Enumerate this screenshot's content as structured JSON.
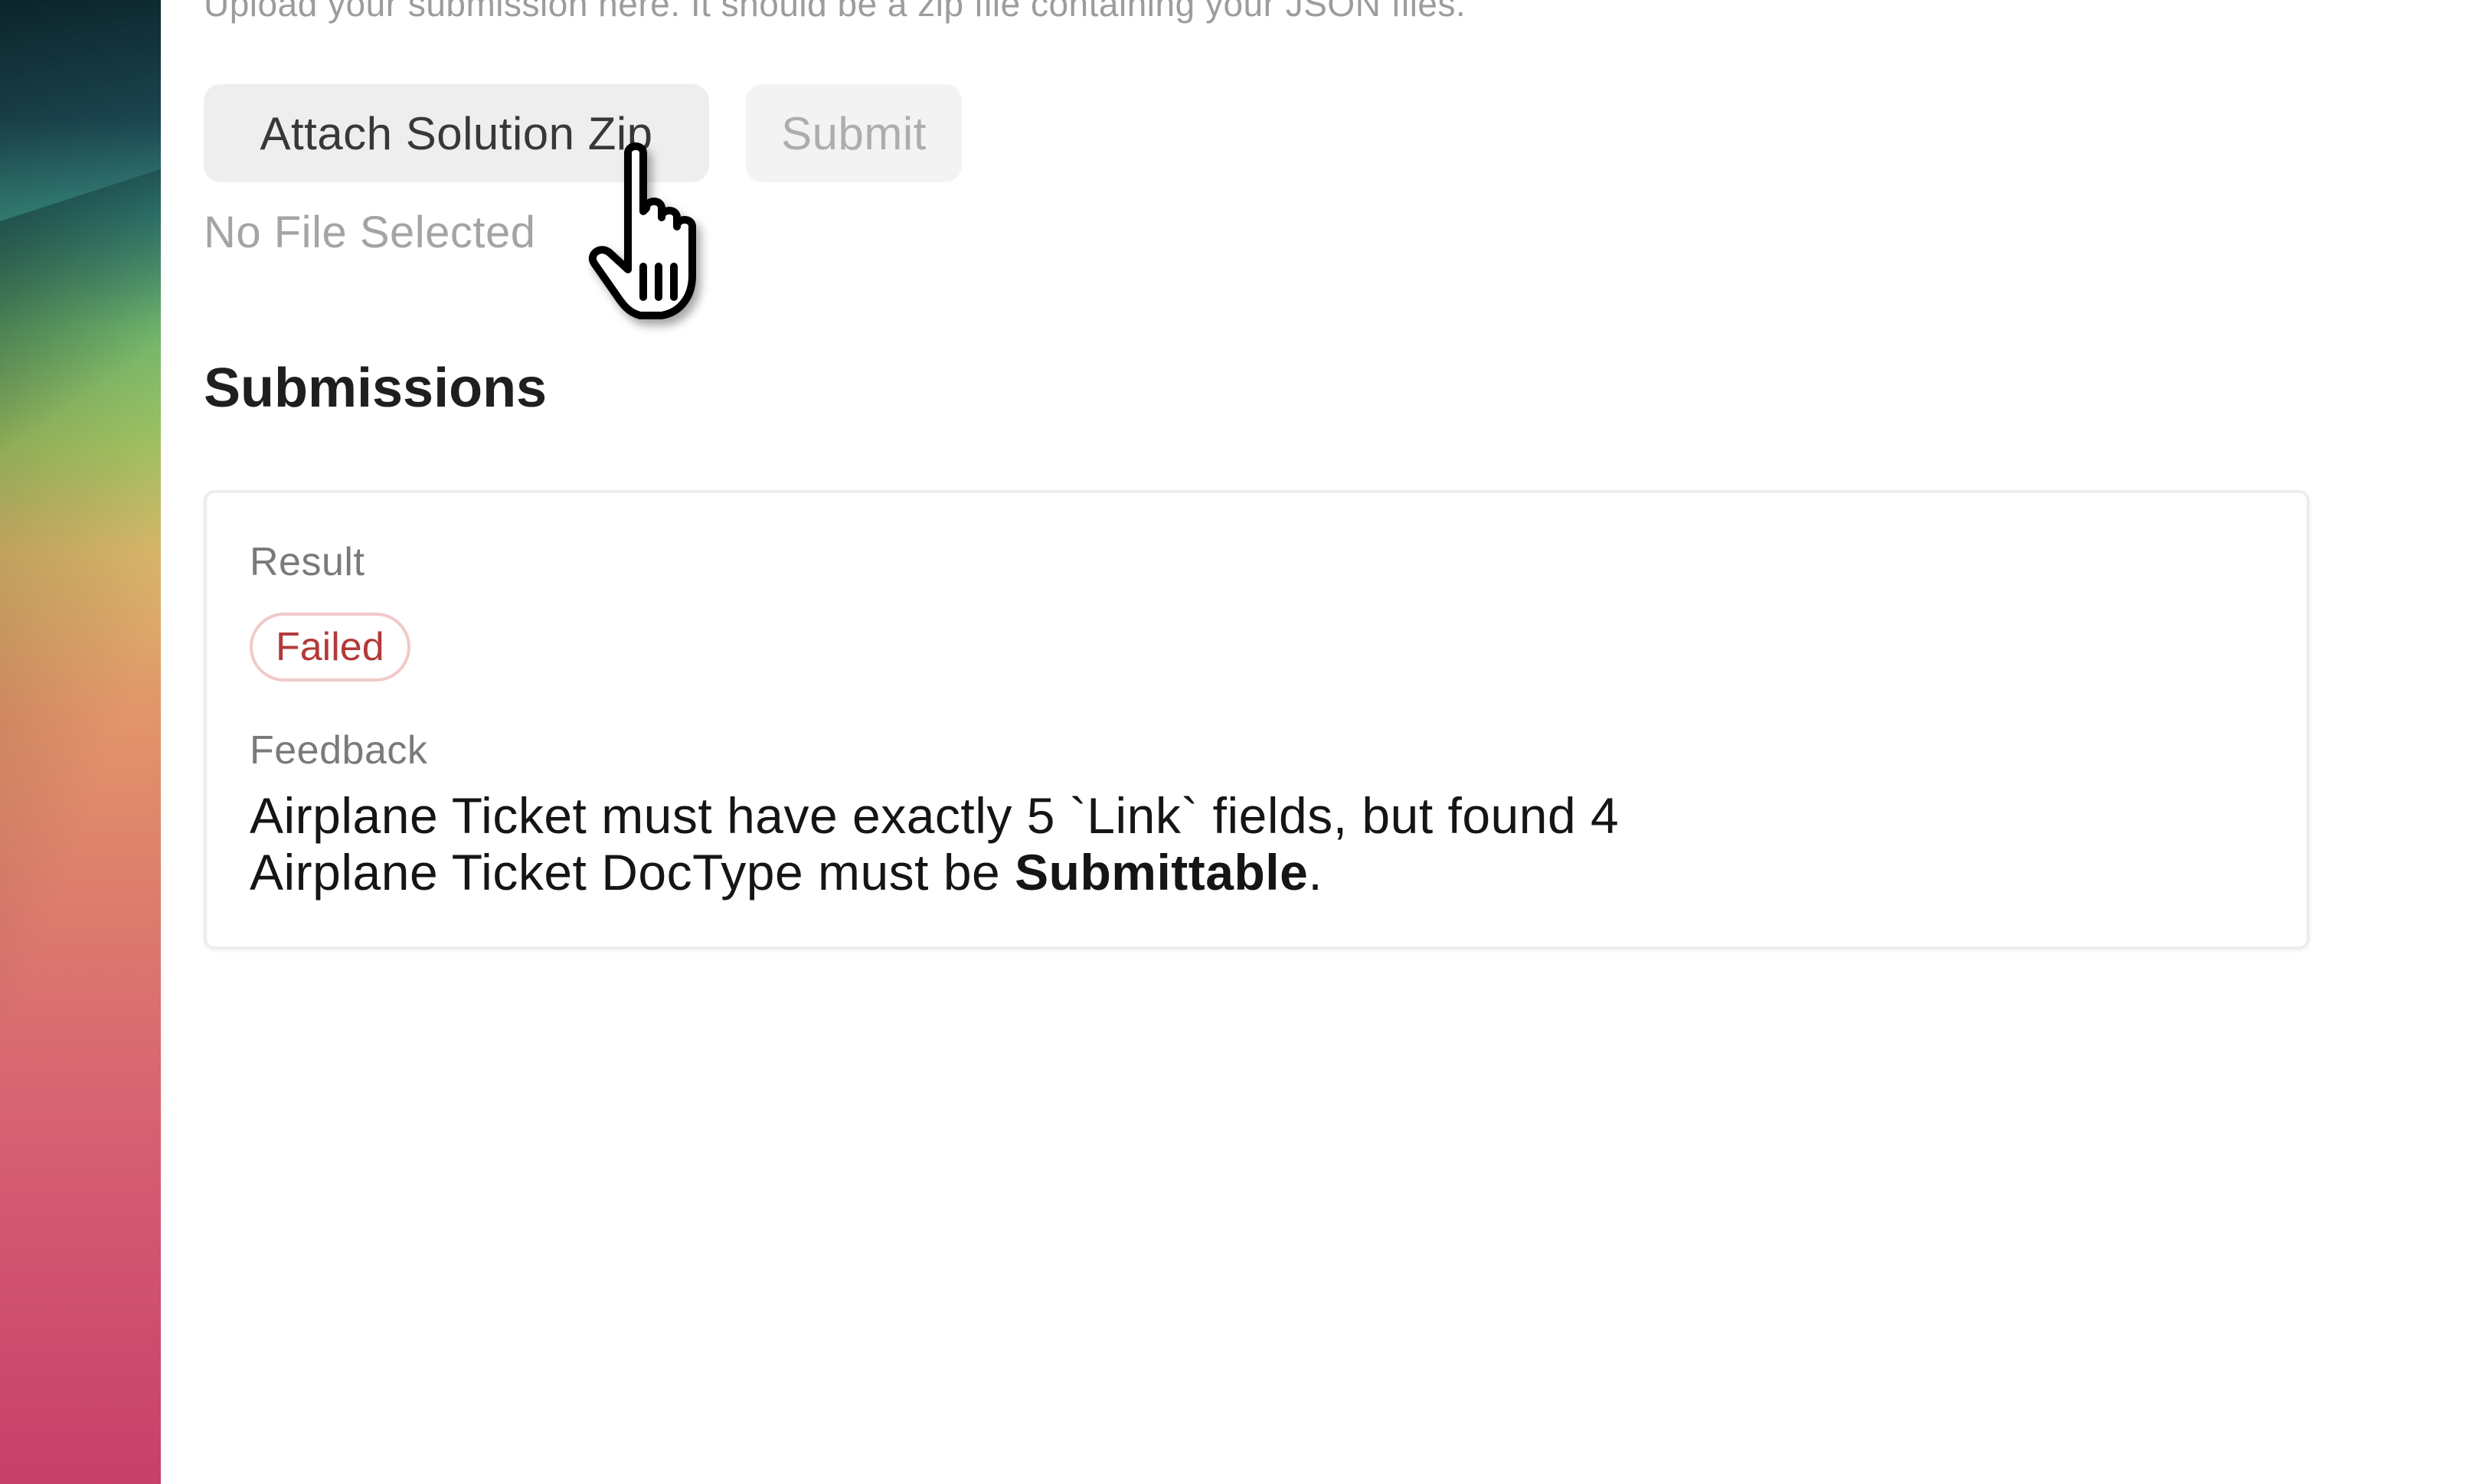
{
  "upload": {
    "intro_text": "Upload your submission here. It should be a zip file containing your JSON files.",
    "attach_button_label": "Attach Solution Zip",
    "submit_button_label": "Submit",
    "file_status": "No File Selected"
  },
  "submissions": {
    "heading": "Submissions",
    "items": [
      {
        "result_label": "Result",
        "result_value": "Failed",
        "feedback_label": "Feedback",
        "feedback_line_1": "Airplane Ticket must have exactly 5 `Link` fields, but found 4",
        "feedback_line_2_prefix": "Airplane Ticket DocType must be ",
        "feedback_line_2_bold": "Submittable",
        "feedback_line_2_suffix": "."
      }
    ]
  },
  "cursor": {
    "icon": "pointing-hand-cursor-icon"
  },
  "colors": {
    "failed_text": "#b23a3a",
    "failed_border": "#f2c9c9",
    "button_bg": "#eeeeee",
    "muted_text": "#a4a4a4"
  }
}
